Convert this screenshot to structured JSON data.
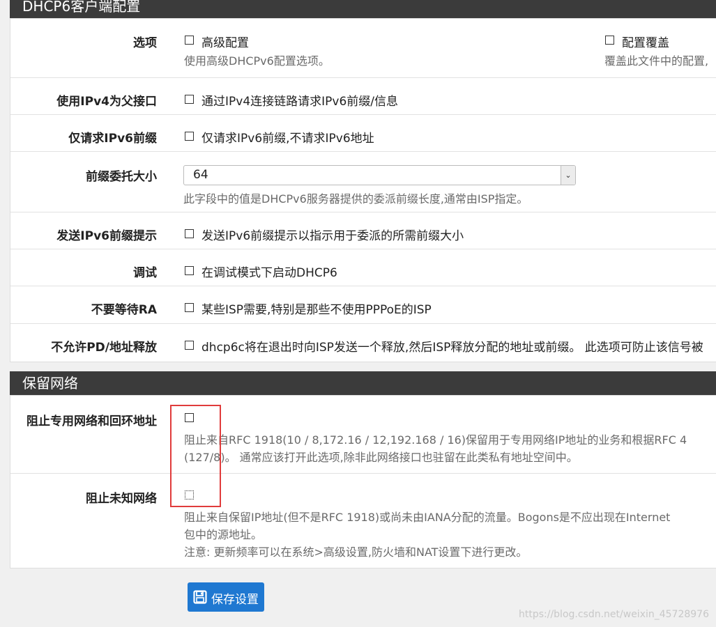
{
  "dhcp6_section": {
    "title": "DHCP6客户端配置",
    "options": {
      "label": "选项",
      "advanced_label": "高级配置",
      "advanced_help": "使用高级DHCPv6配置选项。",
      "override_label": "配置覆盖",
      "override_help": "覆盖此文件中的配置,"
    },
    "ipv4_parent": {
      "label": "使用IPv4为父接口",
      "text": "通过IPv4连接链路请求IPv6前缀/信息"
    },
    "prefix_only": {
      "label": "仅请求IPv6前缀",
      "text": "仅请求IPv6前缀,不请求IPv6地址"
    },
    "prefix_size": {
      "label": "前缀委托大小",
      "value": "64",
      "help": "此字段中的值是DHCPv6服务器提供的委派前缀长度,通常由ISP指定。"
    },
    "prefix_hint": {
      "label": "发送IPv6前缀提示",
      "text": "发送IPv6前缀提示以指示用于委派的所需前缀大小"
    },
    "debug": {
      "label": "调试",
      "text": "在调试模式下启动DHCP6"
    },
    "no_wait_ra": {
      "label": "不要等待RA",
      "text": "某些ISP需要,特别是那些不使用PPPoE的ISP"
    },
    "no_release": {
      "label": "不允许PD/地址释放",
      "text": "dhcp6c将在退出时向ISP发送一个释放,然后ISP释放分配的地址或前缀。 此选项可防止该信号被"
    }
  },
  "reserved_section": {
    "title": "保留网络",
    "block_private": {
      "label": "阻止专用网络和回环地址",
      "help_line1": "阻止来自RFC 1918(10 / 8,172.16 / 12,192.168 / 16)保留用于专用网络IP地址的业务和根据RFC 4",
      "help_line2": "(127/8)。 通常应该打开此选项,除非此网络接口也驻留在此类私有地址空间中。"
    },
    "block_bogons": {
      "label": "阻止未知网络",
      "help_line1": "阻止来自保留IP地址(但不是RFC 1918)或尚未由IANA分配的流量。Bogons是不应出现在Internet",
      "help_line2": "包中的源地址。",
      "help_line3": "注意: 更新频率可以在系统>高级设置,防火墙和NAT设置下进行更改。"
    }
  },
  "save_button": {
    "label": "保存设置",
    "icon": "floppy-disk-icon"
  },
  "watermark": "https://blog.csdn.net/weixin_45728976",
  "colors": {
    "heading_bg": "#3b3b3b",
    "primary": "#1f78d1",
    "highlight": "#e03b3b"
  }
}
